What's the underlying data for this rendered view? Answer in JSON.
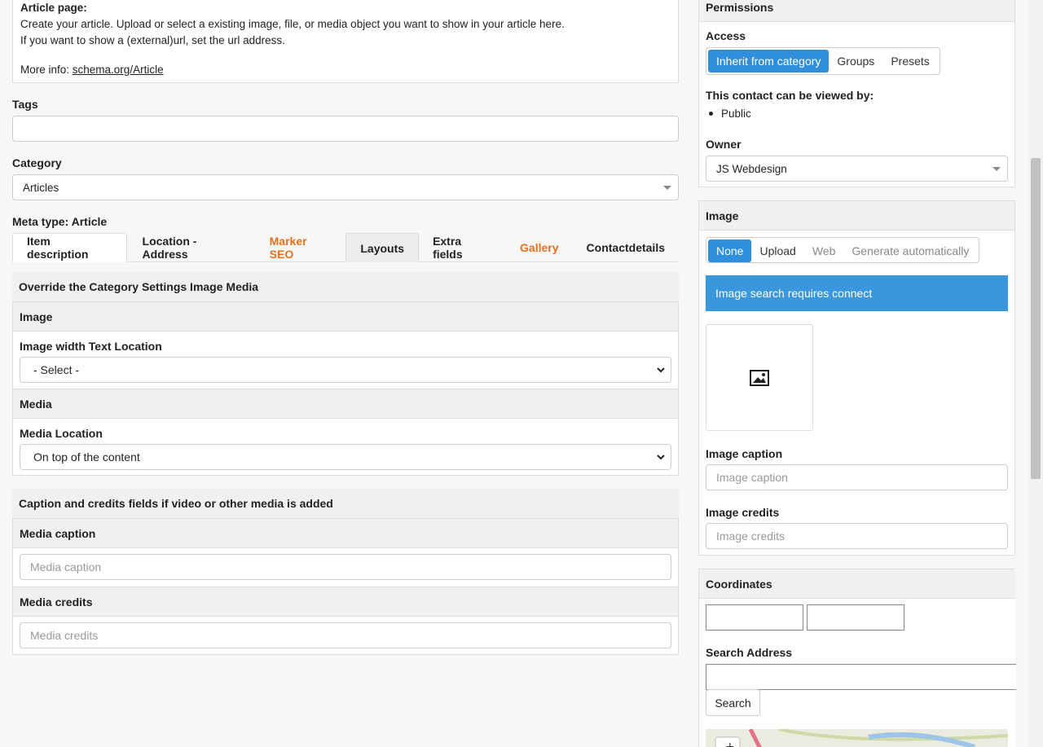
{
  "info": {
    "title": "Article page:",
    "line1": "Create your article. Upload or select a existing image, file, or media object you want to show in your article here.",
    "line2": "If you want to show a (external)url, set the url address.",
    "more_label": "More info: ",
    "more_link": "schema.org/Article"
  },
  "tags": {
    "label": "Tags"
  },
  "category": {
    "label": "Category",
    "value": "Articles"
  },
  "meta_type": "Meta type: Article",
  "tabs": [
    {
      "label": "Item description"
    },
    {
      "label": "Location - Address"
    },
    {
      "label": "Marker SEO"
    },
    {
      "label": "Layouts"
    },
    {
      "label": "Extra fields"
    },
    {
      "label": "Gallery"
    },
    {
      "label": "Contactdetails"
    }
  ],
  "override": {
    "title": "Override the Category Settings Image Media",
    "image_section": "Image",
    "image_width_label": "Image width Text Location",
    "image_width_value": "- Select -",
    "media_section": "Media",
    "media_location_label": "Media Location",
    "media_location_value": "On top of the content"
  },
  "caption_panel": {
    "title": "Caption and credits fields if video or other media is added",
    "caption_label": "Media caption",
    "caption_placeholder": "Media caption",
    "credits_label": "Media credits",
    "credits_placeholder": "Media credits"
  },
  "permissions": {
    "title": "Permissions",
    "access_label": "Access",
    "access_options": [
      "Inherit from category",
      "Groups",
      "Presets"
    ],
    "viewed_by_label": "This contact can be viewed by:",
    "viewed_by": "Public",
    "owner_label": "Owner",
    "owner_value": "JS Webdesign"
  },
  "image": {
    "title": "Image",
    "options": [
      "None",
      "Upload",
      "Web",
      "Generate automatically"
    ],
    "banner": "Image search requires connect",
    "caption_label": "Image caption",
    "caption_placeholder": "Image caption",
    "credits_label": "Image credits",
    "credits_placeholder": "Image credits"
  },
  "coordinates": {
    "title": "Coordinates",
    "search_label": "Search Address",
    "search_button": "Search"
  },
  "colors": {
    "accent": "#2f8fdb",
    "orange": "#e8701a"
  }
}
